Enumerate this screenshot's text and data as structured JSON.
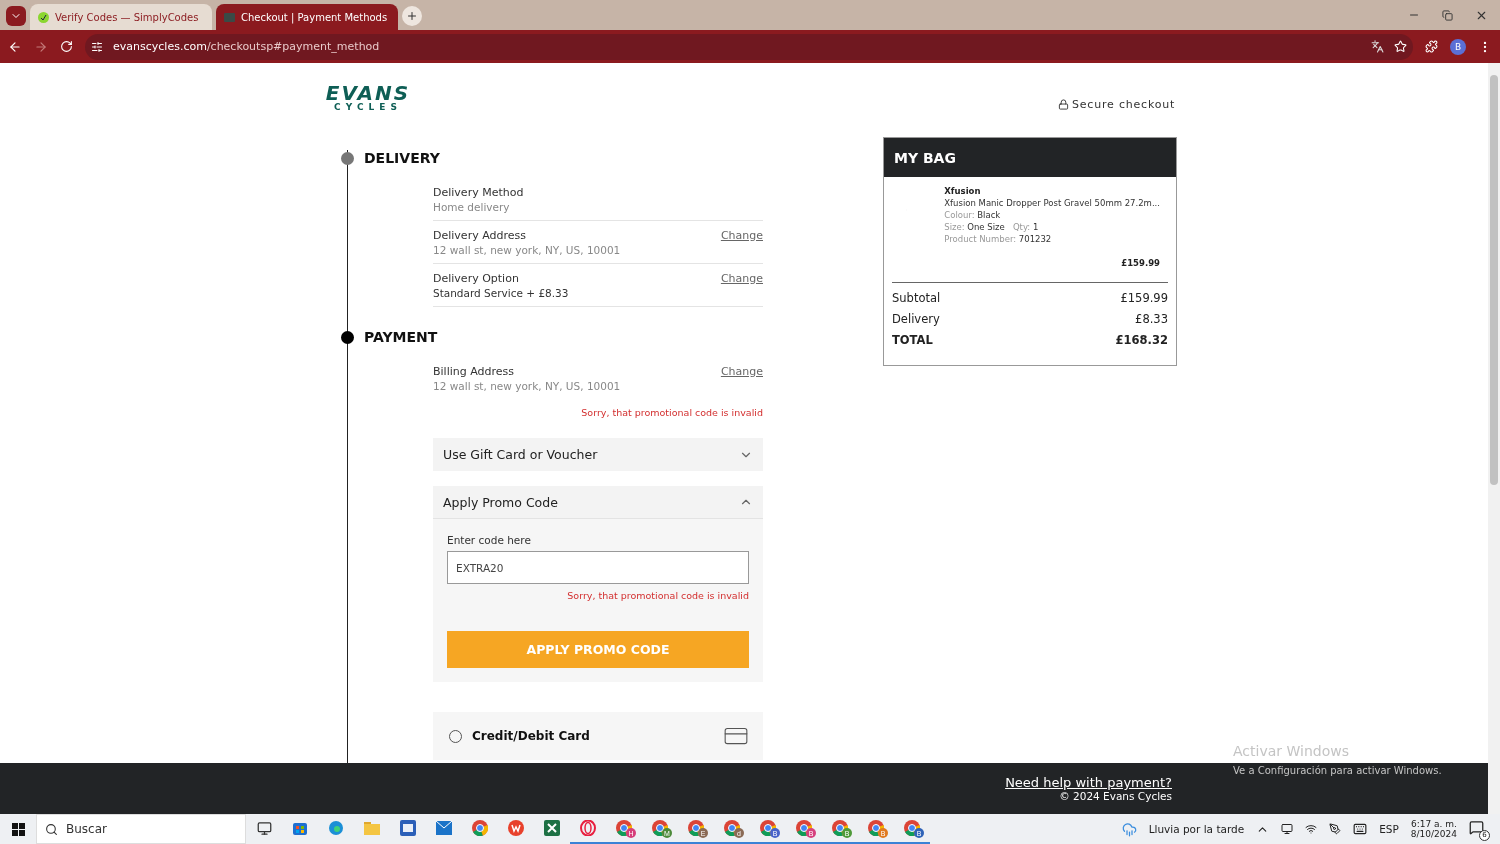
{
  "browser": {
    "tabs": [
      {
        "title": "Verify Codes — SimplyCodes",
        "selected": false,
        "kind": "check"
      },
      {
        "title": "Checkout | Payment Methods",
        "selected": true,
        "kind": "site"
      }
    ],
    "url_host": "evanscycles.com",
    "url_path": "/checkoutsp#payment_method",
    "profile": "B"
  },
  "header": {
    "logo_top": "EVANS",
    "logo_bottom": "CYCLES",
    "secure": "Secure checkout"
  },
  "steps": [
    {
      "title": "DELIVERY",
      "kind": "done",
      "rows": [
        {
          "label": "Delivery Method",
          "value": "Home delivery",
          "value_strong": false
        },
        {
          "label": "Delivery Address",
          "value": "12 wall st, new york, NY, US, 10001",
          "value_strong": false,
          "action": "Change"
        },
        {
          "label": "Delivery Option",
          "value": "Standard Service + £8.33",
          "value_strong": true,
          "action": "Change"
        }
      ]
    },
    {
      "title": "PAYMENT",
      "kind": "current",
      "rows": [
        {
          "label": "Billing Address",
          "value": "12 wall st, new york, NY, US, 10001",
          "value_strong": false,
          "action": "Change"
        }
      ]
    }
  ],
  "payment": {
    "error": "Sorry, that promotional code is invalid",
    "accordions": [
      {
        "title": "Use Gift Card or Voucher",
        "expanded": false
      },
      {
        "title": "Apply Promo Code",
        "expanded": true,
        "field_label": "Enter code here",
        "value": "EXTRA20",
        "error": "Sorry, that promotional code is invalid",
        "button": "APPLY PROMO CODE"
      }
    ],
    "method": {
      "label": "Credit/Debit Card",
      "selected": false
    }
  },
  "bag": {
    "title": "MY BAG",
    "item": {
      "brand": "Xfusion",
      "name": "Xfusion Manic Dropper Post Gravel 50mm 27.2m...",
      "colour_label": "Colour:",
      "colour": "Black",
      "size_label": "Size:",
      "size": "One Size",
      "qty_label": "Qty:",
      "qty": "1",
      "number_label": "Product Number:",
      "number": "701232",
      "price": "£159.99"
    },
    "totals": [
      {
        "label": "Subtotal",
        "value": "£159.99",
        "strong": false
      },
      {
        "label": "Delivery",
        "value": "£8.33",
        "strong": false
      },
      {
        "label": "TOTAL",
        "value": "£168.32",
        "strong": true
      }
    ]
  },
  "footer": {
    "help": "Need help with payment?",
    "copyright": "© 2024 Evans Cycles"
  },
  "windows_notice": {
    "title": "Activar Windows",
    "text": "Ve a Configuración para activar Windows."
  },
  "taskbar": {
    "search": "Buscar",
    "apps": [
      {
        "kind": "taskview",
        "running": false
      },
      {
        "kind": "store",
        "running": false
      },
      {
        "kind": "edge",
        "running": false
      },
      {
        "kind": "folder",
        "running": false
      },
      {
        "kind": "word",
        "running": false
      },
      {
        "kind": "mail",
        "running": false
      },
      {
        "kind": "chrome",
        "running": false
      },
      {
        "kind": "wps",
        "running": false
      },
      {
        "kind": "excel",
        "running": false
      },
      {
        "kind": "opera",
        "running": true
      },
      {
        "kind": "chrome",
        "running": true,
        "badge": "H",
        "color": "#d63d7a"
      },
      {
        "kind": "chrome",
        "running": true,
        "badge": "M",
        "color": "#4c8a3a"
      },
      {
        "kind": "chrome",
        "running": true,
        "badge": "E",
        "color": "#8a6a55"
      },
      {
        "kind": "chrome",
        "running": true,
        "badge": "d",
        "color": "#8a6a55"
      },
      {
        "kind": "chrome",
        "running": true,
        "badge": "B",
        "color": "#4a63c9"
      },
      {
        "kind": "chrome",
        "running": true,
        "badge": "B",
        "color": "#d6407e"
      },
      {
        "kind": "chrome",
        "running": true,
        "badge": "B",
        "color": "#4f9a3a"
      },
      {
        "kind": "chrome",
        "running": true,
        "badge": "B",
        "color": "#e07a20"
      },
      {
        "kind": "chrome",
        "running": true,
        "badge": "B",
        "color": "#2f63b8"
      }
    ],
    "weather": "Lluvia por la tarde",
    "lang": "ESP",
    "time": "6:17 a. m.",
    "date": "8/10/2024",
    "notifications": "6"
  }
}
